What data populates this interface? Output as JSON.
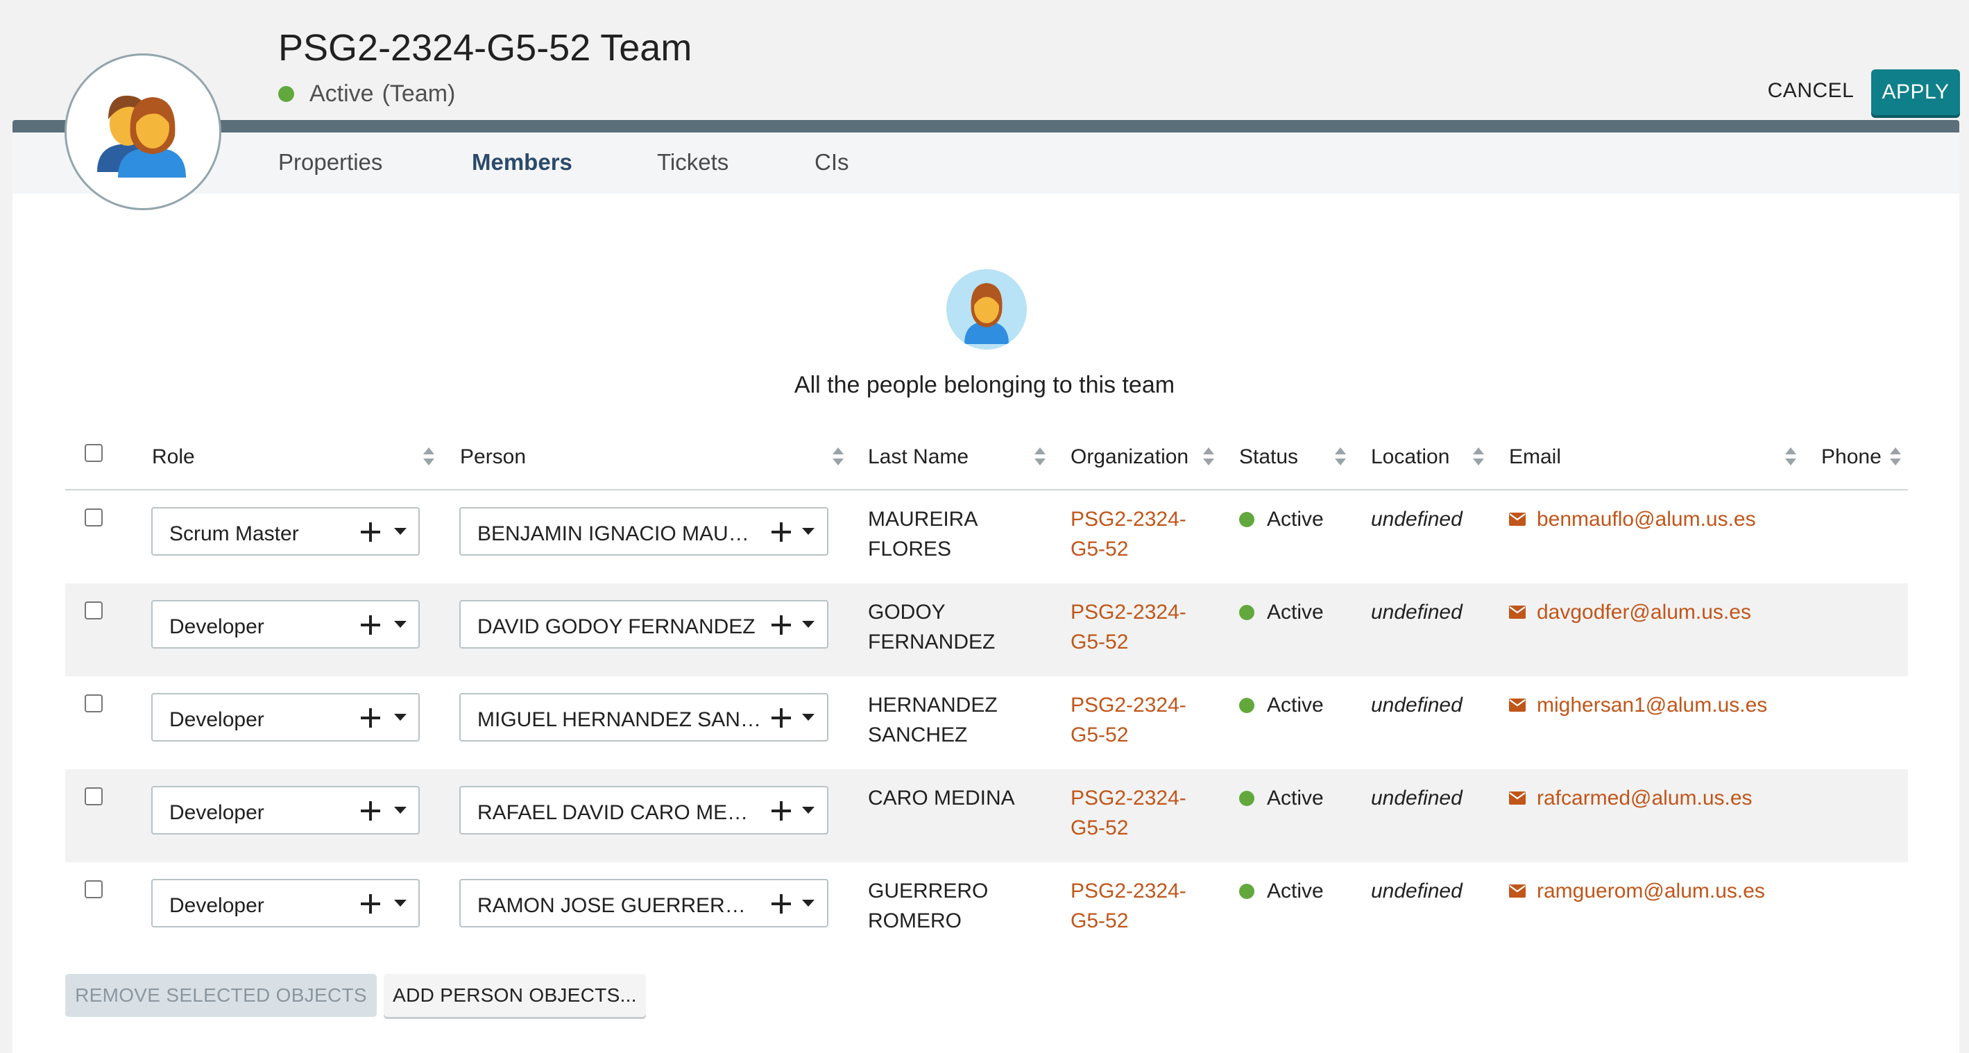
{
  "header": {
    "title": "PSG2-2324-G5-52 Team",
    "status": "Active",
    "status_sub": "(Team)",
    "status_color": "#62a83d",
    "cancel_label": "CANCEL",
    "apply_label": "APPLY",
    "accent_color": "#0f7f8a"
  },
  "tabs": [
    {
      "label": "Properties",
      "active": false
    },
    {
      "label": "Members",
      "active": true
    },
    {
      "label": "Tickets",
      "active": false
    },
    {
      "label": "CIs",
      "active": false
    }
  ],
  "intro_text": "All the people belonging to this team",
  "table": {
    "columns": [
      "Role",
      "Person",
      "Last Name",
      "Organization",
      "Status",
      "Location",
      "Email",
      "Phone"
    ],
    "rows": [
      {
        "role": "Scrum Master",
        "person": "BENJAMIN IGNACIO MAUREI…",
        "last_name_1": "MAUREIRA",
        "last_name_2": "FLORES",
        "org_1": "PSG2-2324-",
        "org_2": "G5-52",
        "status": "Active",
        "location": "undefined",
        "email": "benmauflo@alum.us.es",
        "phone": ""
      },
      {
        "role": "Developer",
        "person": "DAVID GODOY FERNANDEZ",
        "last_name_1": "GODOY",
        "last_name_2": "FERNANDEZ",
        "org_1": "PSG2-2324-",
        "org_2": "G5-52",
        "status": "Active",
        "location": "undefined",
        "email": "davgodfer@alum.us.es",
        "phone": ""
      },
      {
        "role": "Developer",
        "person": "MIGUEL HERNANDEZ SANCH…",
        "last_name_1": "HERNANDEZ",
        "last_name_2": "SANCHEZ",
        "org_1": "PSG2-2324-",
        "org_2": "G5-52",
        "status": "Active",
        "location": "undefined",
        "email": "mighersan1@alum.us.es",
        "phone": ""
      },
      {
        "role": "Developer",
        "person": "RAFAEL DAVID CARO MEDINA",
        "last_name_1": "CARO MEDINA",
        "last_name_2": "",
        "org_1": "PSG2-2324-",
        "org_2": "G5-52",
        "status": "Active",
        "location": "undefined",
        "email": "rafcarmed@alum.us.es",
        "phone": ""
      },
      {
        "role": "Developer",
        "person": "RAMON JOSE GUERRERO RO…",
        "last_name_1": "GUERRERO",
        "last_name_2": "ROMERO",
        "org_1": "PSG2-2324-",
        "org_2": "G5-52",
        "status": "Active",
        "location": "undefined",
        "email": "ramguerom@alum.us.es",
        "phone": ""
      }
    ]
  },
  "footer": {
    "remove_label": "REMOVE SELECTED OBJECTS",
    "add_label": "ADD PERSON OBJECTS..."
  },
  "icons": {
    "team": "team-avatar-icon",
    "person": "person-avatar-icon",
    "email": "envelope-icon",
    "add": "plus-icon",
    "dropdown": "caret-down-icon",
    "sort": "sort-icon"
  }
}
